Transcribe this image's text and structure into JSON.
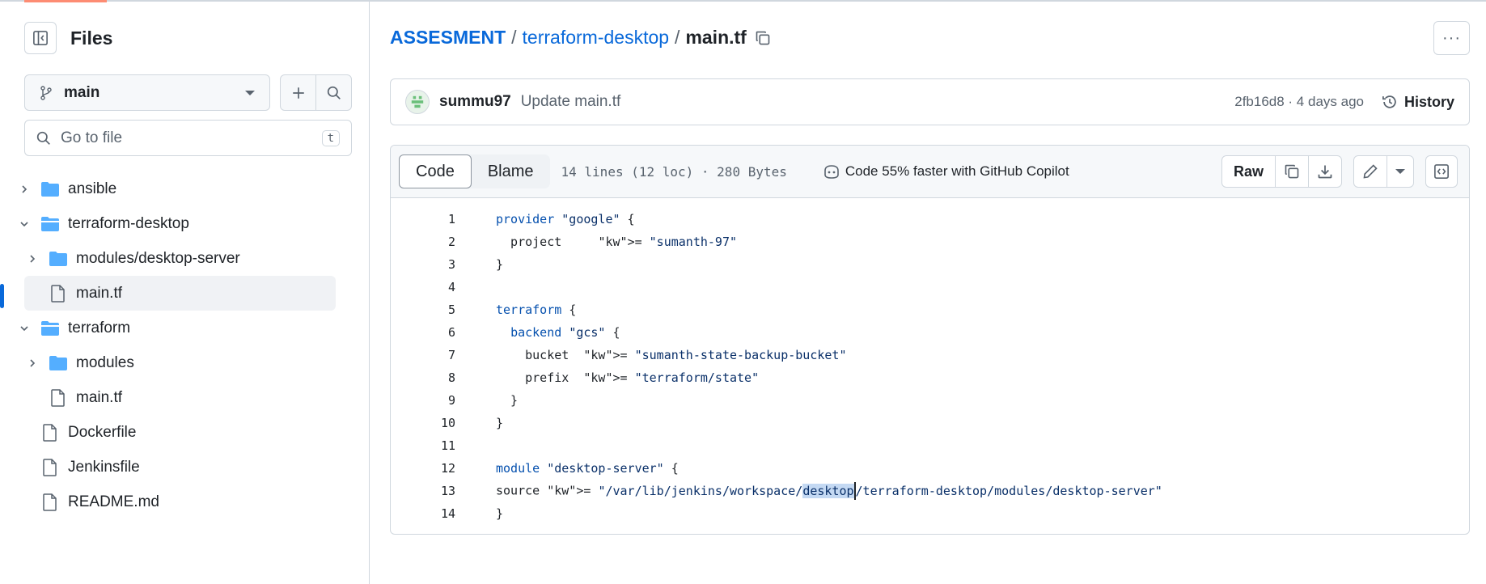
{
  "sidebar": {
    "title": "Files",
    "branch": "main",
    "goto_placeholder": "Go to file",
    "goto_shortcut": "t",
    "tree": [
      {
        "label": "ansible",
        "type": "folder",
        "expanded": false,
        "indent": 0
      },
      {
        "label": "terraform-desktop",
        "type": "folder",
        "expanded": true,
        "indent": 0
      },
      {
        "label": "modules/desktop-server",
        "type": "folder",
        "expanded": false,
        "indent": 1
      },
      {
        "label": "main.tf",
        "type": "file",
        "selected": true,
        "indent": 1
      },
      {
        "label": "terraform",
        "type": "folder",
        "expanded": true,
        "indent": 0
      },
      {
        "label": "modules",
        "type": "folder",
        "expanded": false,
        "indent": 1
      },
      {
        "label": "main.tf",
        "type": "file",
        "indent": 1
      },
      {
        "label": "Dockerfile",
        "type": "file",
        "indent": 0
      },
      {
        "label": "Jenkinsfile",
        "type": "file",
        "indent": 0
      },
      {
        "label": "README.md",
        "type": "file",
        "indent": 0
      }
    ]
  },
  "breadcrumb": {
    "root": "ASSESMENT",
    "sep": "/",
    "folder": "terraform-desktop",
    "file": "main.tf"
  },
  "commit": {
    "author": "summu97",
    "message": "Update main.tf",
    "sha_time": "2fb16d8 · 4 days ago",
    "history_label": "History"
  },
  "toolbar": {
    "code_tab": "Code",
    "blame_tab": "Blame",
    "file_info": "14 lines (12 loc) · 280 Bytes",
    "copilot": "Code 55% faster with GitHub Copilot",
    "raw": "Raw"
  },
  "code_lines": [
    {
      "n": "1",
      "t": "provider \"google\" {"
    },
    {
      "n": "2",
      "t": "  project     = \"sumanth-97\""
    },
    {
      "n": "3",
      "t": "}"
    },
    {
      "n": "4",
      "t": ""
    },
    {
      "n": "5",
      "t": "terraform {"
    },
    {
      "n": "6",
      "t": "  backend \"gcs\" {"
    },
    {
      "n": "7",
      "t": "    bucket  = \"sumanth-state-backup-bucket\""
    },
    {
      "n": "8",
      "t": "    prefix  = \"terraform/state\""
    },
    {
      "n": "9",
      "t": "  }"
    },
    {
      "n": "10",
      "t": "}"
    },
    {
      "n": "11",
      "t": ""
    },
    {
      "n": "12",
      "t": "module \"desktop-server\" {"
    },
    {
      "n": "13",
      "t": "source = \"/var/lib/jenkins/workspace/desktop/terraform-desktop/modules/desktop-server\""
    },
    {
      "n": "14",
      "t": "}"
    }
  ],
  "selected_text": "desktop",
  "colors": {
    "accent": "#0969da",
    "folder": "#54aeff"
  }
}
